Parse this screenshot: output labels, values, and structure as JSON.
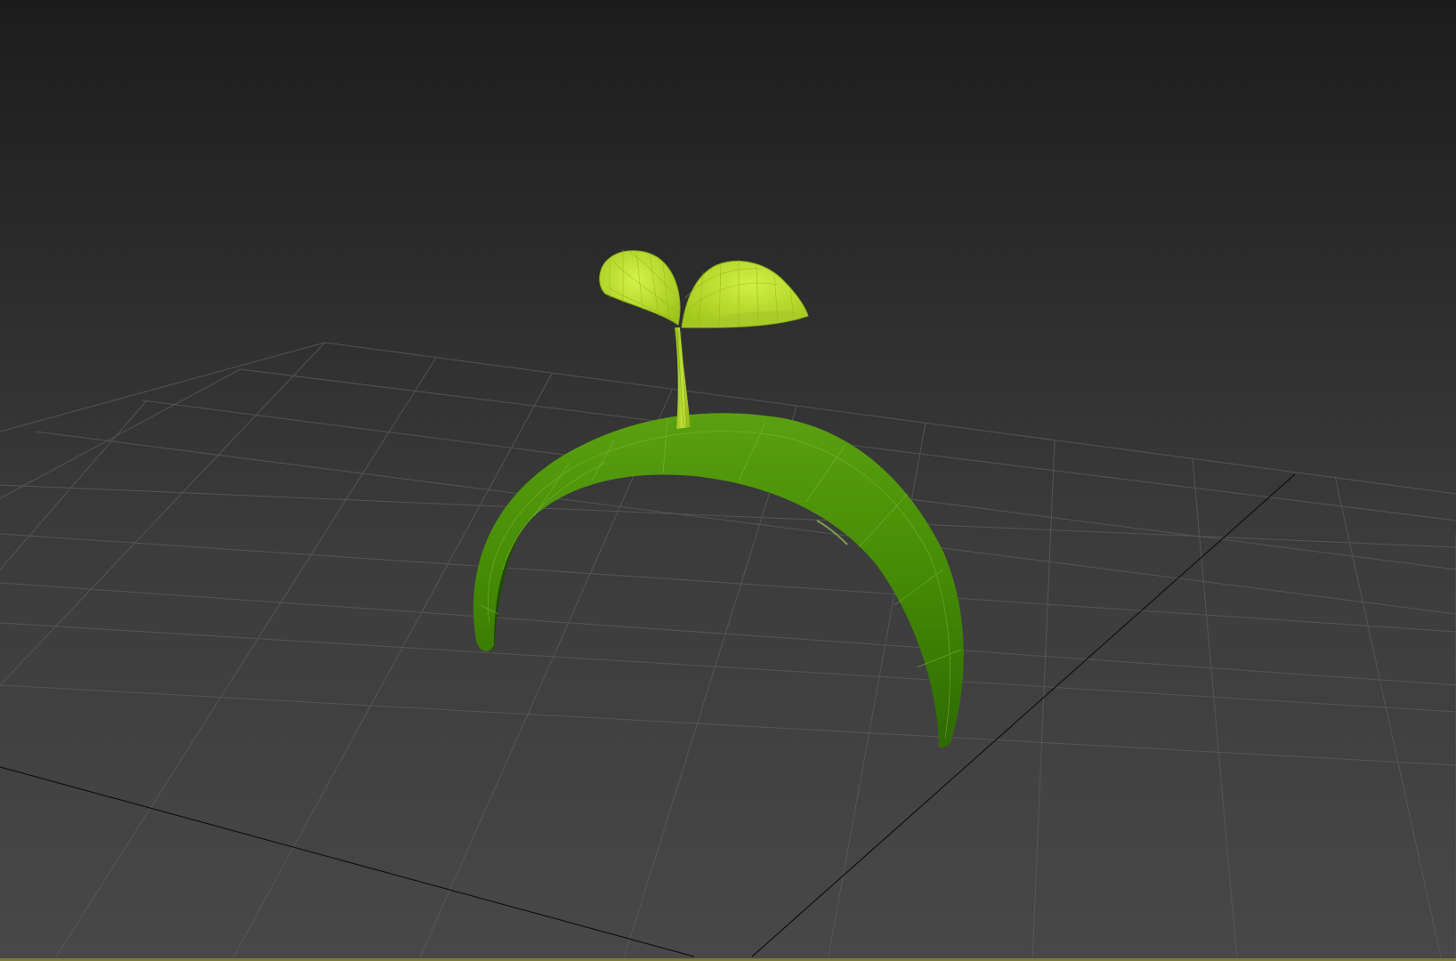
{
  "viewport": {
    "view": "perspective",
    "shading": "smooth-and-wireframe",
    "grid_visible": true,
    "active_viewport_border_color": "#7d7a3a"
  },
  "scene": {
    "objects": [
      {
        "name": "sprout-stem",
        "color": "#b8e02a"
      },
      {
        "name": "sprout-leaf-left",
        "color": "#b8e02a"
      },
      {
        "name": "sprout-leaf-right",
        "color": "#b8e02a"
      },
      {
        "name": "arch-band",
        "color": "#4a8a08"
      }
    ],
    "background_top_color": "#1c1c1c",
    "background_bottom_color": "#484848",
    "grid_color": "#5a5a5a",
    "grid_axis_color": "#111111"
  }
}
